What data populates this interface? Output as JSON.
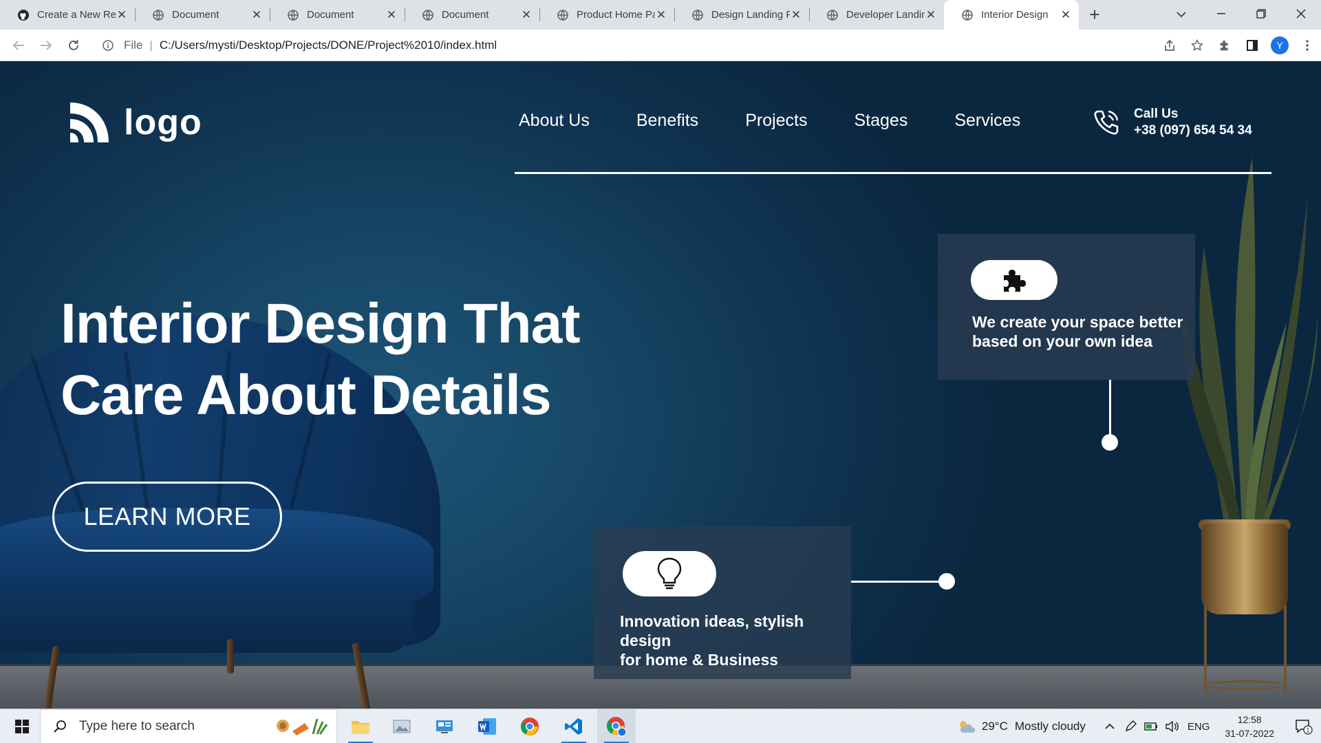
{
  "browser": {
    "tabs": [
      {
        "title": "Create a New Rep",
        "icon": "github-icon"
      },
      {
        "title": "Document",
        "icon": "globe-icon"
      },
      {
        "title": "Document",
        "icon": "globe-icon"
      },
      {
        "title": "Document",
        "icon": "globe-icon"
      },
      {
        "title": "Product Home Pa",
        "icon": "globe-icon"
      },
      {
        "title": "Design Landing P",
        "icon": "globe-icon"
      },
      {
        "title": "Developer Landin",
        "icon": "globe-icon"
      },
      {
        "title": "Interior Design",
        "icon": "globe-icon",
        "active": true
      }
    ],
    "address": {
      "scheme_label": "File",
      "url": "C:/Users/mysti/Desktop/Projects/DONE/Project%2010/index.html"
    },
    "profile_initial": "Y"
  },
  "site": {
    "logo_text": "logo",
    "nav": [
      "About Us",
      "Benefits",
      "Projects",
      "Stages",
      "Services"
    ],
    "call": {
      "label": "Call Us",
      "number": "+38 (097) 654 54 34"
    },
    "hero": {
      "title_line1": "Interior Design That",
      "title_line2": "Care About Details",
      "cta": "LEARN MORE"
    },
    "features": [
      {
        "icon": "puzzle-icon",
        "text_line1": "We create your space better",
        "text_line2": "based on your own idea"
      },
      {
        "icon": "lightbulb-icon",
        "text_line1": "Innovation ideas, stylish",
        "text_line2": "design",
        "text_line3": "for home & Business"
      }
    ]
  },
  "taskbar": {
    "search_placeholder": "Type here to search",
    "weather": {
      "temp": "29°C",
      "condition": "Mostly cloudy"
    },
    "language": "ENG",
    "time": "12:58",
    "date": "31-07-2022",
    "notification_count": "1"
  }
}
